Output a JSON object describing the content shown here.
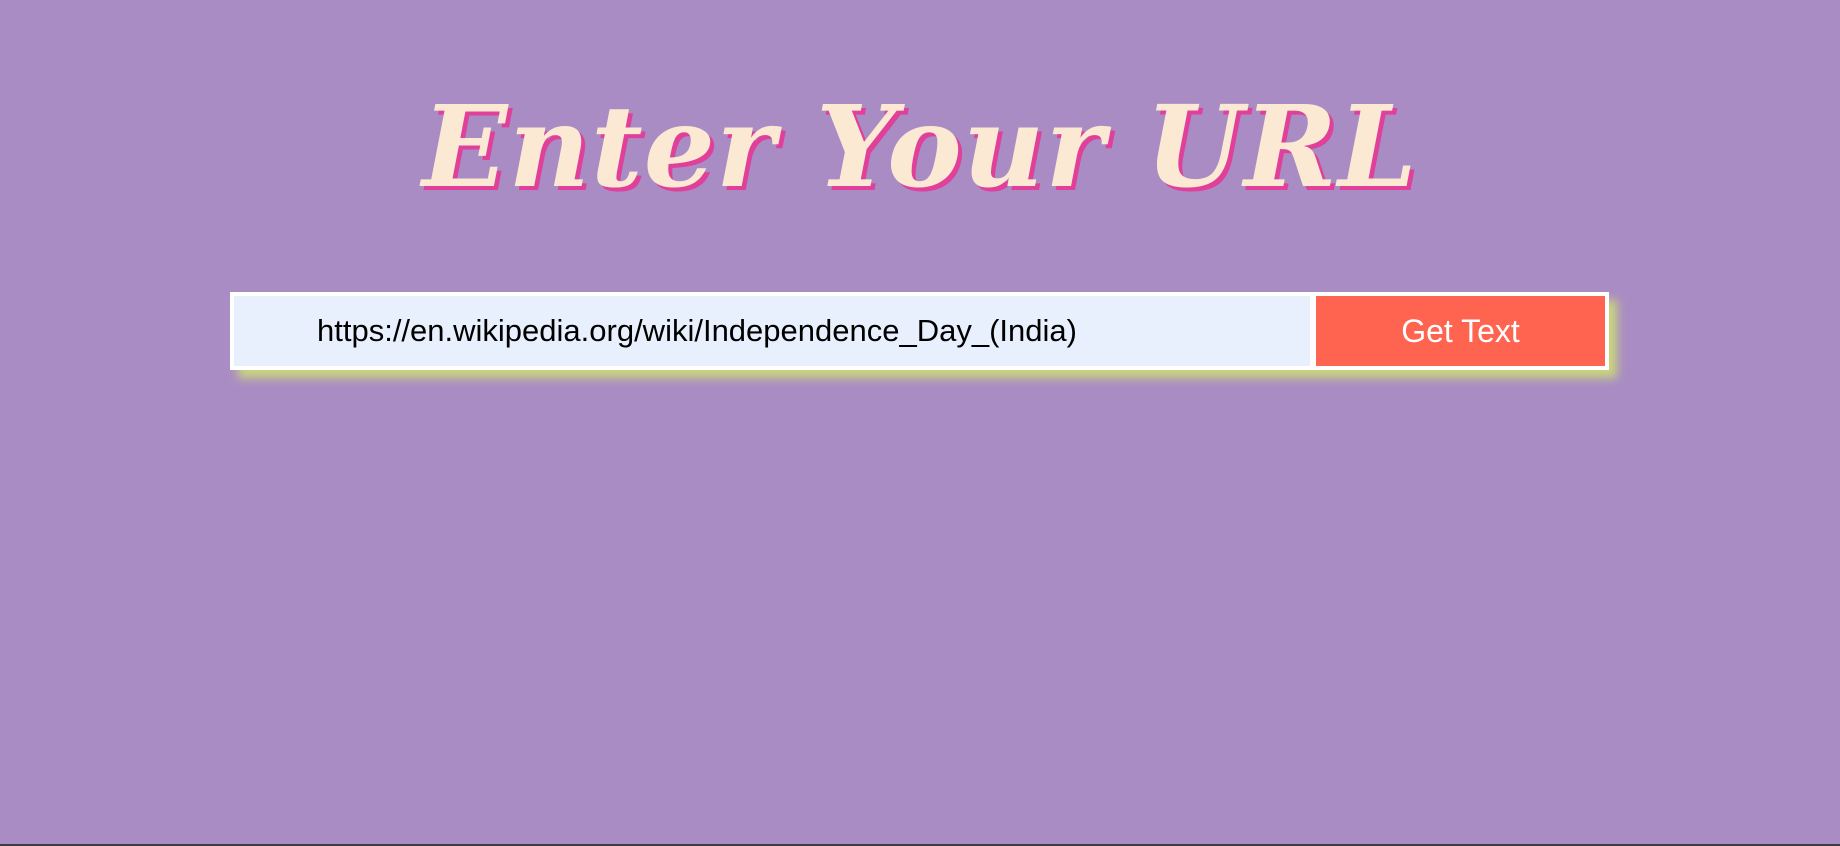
{
  "header": {
    "title": "Enter Your URL"
  },
  "form": {
    "url_value": "https://en.wikipedia.org/wiki/Independence_Day_(India)",
    "submit_label": "Get Text"
  },
  "colors": {
    "background": "#a98cc4",
    "title_text": "#fbe9d3",
    "title_shadow": "#e0409a",
    "input_background": "#e8f0fd",
    "button_background": "#ff6450",
    "button_text": "#ffffff",
    "form_shadow": "#c9d67c"
  }
}
